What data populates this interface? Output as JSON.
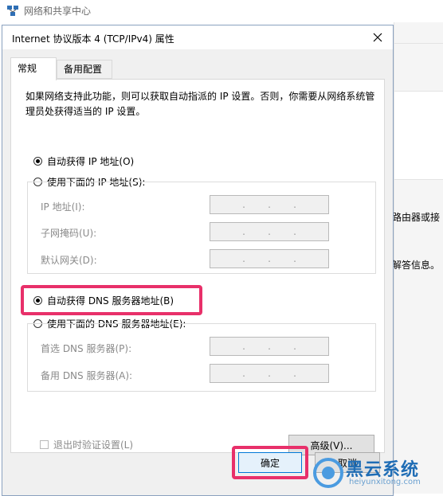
{
  "background_window": {
    "title": "网络和共享中心",
    "side_text_1": "路由器或接",
    "side_text_2": "解答信息。"
  },
  "dialog": {
    "title": "Internet 协议版本 4 (TCP/IPv4) 属性",
    "tabs": [
      {
        "label": "常规",
        "active": true
      },
      {
        "label": "备用配置",
        "active": false
      }
    ],
    "description": "如果网络支持此功能，则可以获取自动指派的 IP 设置。否则，你需要从网络系统管理员处获得适当的 IP 设置。",
    "ip": {
      "auto_label": "自动获得 IP 地址(O)",
      "auto_selected": true,
      "manual_label": "使用下面的 IP 地址(S):",
      "fields": [
        {
          "label": "IP 地址(I):",
          "value": ".   .   ."
        },
        {
          "label": "子网掩码(U):",
          "value": ".   .   ."
        },
        {
          "label": "默认网关(D):",
          "value": ".   .   ."
        }
      ]
    },
    "dns": {
      "auto_label": "自动获得 DNS 服务器地址(B)",
      "auto_selected": true,
      "manual_label": "使用下面的 DNS 服务器地址(E):",
      "fields": [
        {
          "label": "首选 DNS 服务器(P):",
          "value": ".   .   ."
        },
        {
          "label": "备用 DNS 服务器(A):",
          "value": ".   .   ."
        }
      ]
    },
    "validate_label": "退出时验证设置(L)",
    "advanced_label": "高级(V)...",
    "ok_label": "确定",
    "cancel_label": "取消"
  },
  "watermark": {
    "brand": "黑云系统",
    "url": "heiyunxitong.com"
  },
  "colors": {
    "highlight": "#e8306a",
    "accent": "#0078d7"
  }
}
